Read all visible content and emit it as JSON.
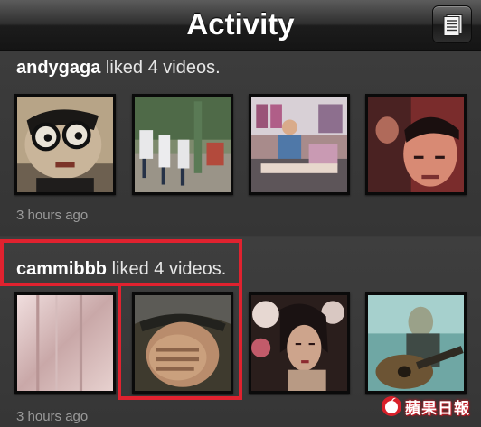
{
  "header": {
    "title": "Activity",
    "list_icon": "list-document-icon"
  },
  "activities": [
    {
      "username": "andygaga",
      "action": " liked 4 videos.",
      "timestamp": "3 hours ago",
      "thumbnails": [
        "video-thumbnail-puppet",
        "video-thumbnail-dancers",
        "video-thumbnail-shop",
        "video-thumbnail-selfie"
      ]
    },
    {
      "username": "cammibbb",
      "action": " liked 4 videos.",
      "timestamp": "3 hours ago",
      "thumbnails": [
        "video-thumbnail-blurred",
        "video-thumbnail-face-covered",
        "video-thumbnail-portrait",
        "video-thumbnail-guitar"
      ]
    }
  ],
  "watermark": {
    "text": "蘋果日報"
  },
  "colors": {
    "highlight": "#e0222f",
    "background": "#3b3b3b",
    "username": "#ffffff",
    "timestamp": "#9b9b9b"
  }
}
